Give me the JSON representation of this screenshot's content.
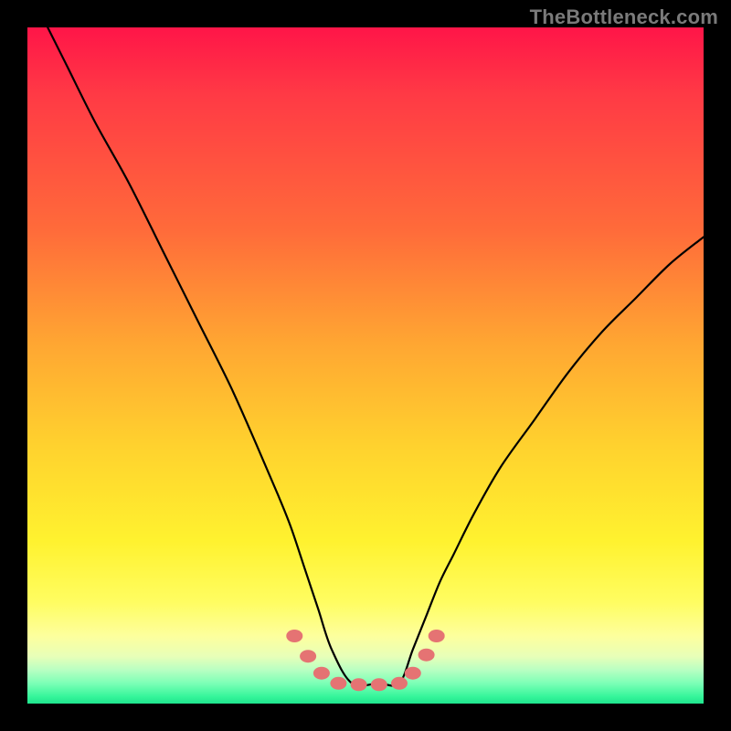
{
  "watermark": "TheBottleneck.com",
  "chart_data": {
    "type": "line",
    "title": "",
    "xlabel": "",
    "ylabel": "",
    "xlim": [
      0,
      100
    ],
    "ylim": [
      0,
      100
    ],
    "series": [
      {
        "name": "bottleneck-curve",
        "x": [
          3,
          6,
          10,
          15,
          20,
          25,
          30,
          34,
          37,
          39,
          41,
          43,
          45,
          48,
          52,
          55,
          57,
          59,
          61,
          63,
          66,
          70,
          75,
          80,
          85,
          90,
          95,
          100
        ],
        "values": [
          100,
          94,
          86,
          77,
          67,
          57,
          47,
          38,
          31,
          26,
          20,
          14,
          8,
          3,
          3,
          3,
          8,
          13,
          18,
          22,
          28,
          35,
          42,
          49,
          55,
          60,
          65,
          69
        ]
      }
    ],
    "markers": {
      "name": "trough-dots",
      "color": "#e57373",
      "x": [
        39.5,
        41.5,
        43.5,
        46,
        49,
        52,
        55,
        57,
        59,
        60.5
      ],
      "values": [
        10,
        7,
        4.5,
        3,
        2.8,
        2.8,
        3,
        4.5,
        7.2,
        10
      ]
    }
  }
}
